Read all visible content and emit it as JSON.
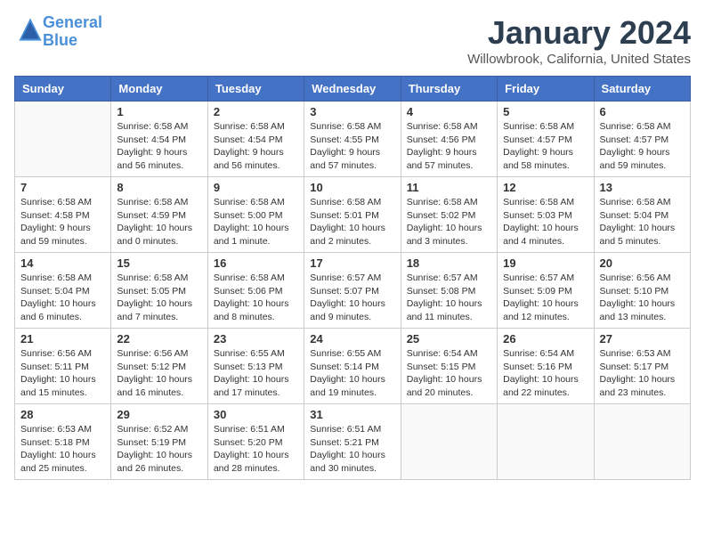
{
  "header": {
    "logo_line1": "General",
    "logo_line2": "Blue",
    "title": "January 2024",
    "location": "Willowbrook, California, United States"
  },
  "weekdays": [
    "Sunday",
    "Monday",
    "Tuesday",
    "Wednesday",
    "Thursday",
    "Friday",
    "Saturday"
  ],
  "weeks": [
    [
      {
        "day": "",
        "info": ""
      },
      {
        "day": "1",
        "info": "Sunrise: 6:58 AM\nSunset: 4:54 PM\nDaylight: 9 hours\nand 56 minutes."
      },
      {
        "day": "2",
        "info": "Sunrise: 6:58 AM\nSunset: 4:54 PM\nDaylight: 9 hours\nand 56 minutes."
      },
      {
        "day": "3",
        "info": "Sunrise: 6:58 AM\nSunset: 4:55 PM\nDaylight: 9 hours\nand 57 minutes."
      },
      {
        "day": "4",
        "info": "Sunrise: 6:58 AM\nSunset: 4:56 PM\nDaylight: 9 hours\nand 57 minutes."
      },
      {
        "day": "5",
        "info": "Sunrise: 6:58 AM\nSunset: 4:57 PM\nDaylight: 9 hours\nand 58 minutes."
      },
      {
        "day": "6",
        "info": "Sunrise: 6:58 AM\nSunset: 4:57 PM\nDaylight: 9 hours\nand 59 minutes."
      }
    ],
    [
      {
        "day": "7",
        "info": "Sunrise: 6:58 AM\nSunset: 4:58 PM\nDaylight: 9 hours\nand 59 minutes."
      },
      {
        "day": "8",
        "info": "Sunrise: 6:58 AM\nSunset: 4:59 PM\nDaylight: 10 hours\nand 0 minutes."
      },
      {
        "day": "9",
        "info": "Sunrise: 6:58 AM\nSunset: 5:00 PM\nDaylight: 10 hours\nand 1 minute."
      },
      {
        "day": "10",
        "info": "Sunrise: 6:58 AM\nSunset: 5:01 PM\nDaylight: 10 hours\nand 2 minutes."
      },
      {
        "day": "11",
        "info": "Sunrise: 6:58 AM\nSunset: 5:02 PM\nDaylight: 10 hours\nand 3 minutes."
      },
      {
        "day": "12",
        "info": "Sunrise: 6:58 AM\nSunset: 5:03 PM\nDaylight: 10 hours\nand 4 minutes."
      },
      {
        "day": "13",
        "info": "Sunrise: 6:58 AM\nSunset: 5:04 PM\nDaylight: 10 hours\nand 5 minutes."
      }
    ],
    [
      {
        "day": "14",
        "info": "Sunrise: 6:58 AM\nSunset: 5:04 PM\nDaylight: 10 hours\nand 6 minutes."
      },
      {
        "day": "15",
        "info": "Sunrise: 6:58 AM\nSunset: 5:05 PM\nDaylight: 10 hours\nand 7 minutes."
      },
      {
        "day": "16",
        "info": "Sunrise: 6:58 AM\nSunset: 5:06 PM\nDaylight: 10 hours\nand 8 minutes."
      },
      {
        "day": "17",
        "info": "Sunrise: 6:57 AM\nSunset: 5:07 PM\nDaylight: 10 hours\nand 9 minutes."
      },
      {
        "day": "18",
        "info": "Sunrise: 6:57 AM\nSunset: 5:08 PM\nDaylight: 10 hours\nand 11 minutes."
      },
      {
        "day": "19",
        "info": "Sunrise: 6:57 AM\nSunset: 5:09 PM\nDaylight: 10 hours\nand 12 minutes."
      },
      {
        "day": "20",
        "info": "Sunrise: 6:56 AM\nSunset: 5:10 PM\nDaylight: 10 hours\nand 13 minutes."
      }
    ],
    [
      {
        "day": "21",
        "info": "Sunrise: 6:56 AM\nSunset: 5:11 PM\nDaylight: 10 hours\nand 15 minutes."
      },
      {
        "day": "22",
        "info": "Sunrise: 6:56 AM\nSunset: 5:12 PM\nDaylight: 10 hours\nand 16 minutes."
      },
      {
        "day": "23",
        "info": "Sunrise: 6:55 AM\nSunset: 5:13 PM\nDaylight: 10 hours\nand 17 minutes."
      },
      {
        "day": "24",
        "info": "Sunrise: 6:55 AM\nSunset: 5:14 PM\nDaylight: 10 hours\nand 19 minutes."
      },
      {
        "day": "25",
        "info": "Sunrise: 6:54 AM\nSunset: 5:15 PM\nDaylight: 10 hours\nand 20 minutes."
      },
      {
        "day": "26",
        "info": "Sunrise: 6:54 AM\nSunset: 5:16 PM\nDaylight: 10 hours\nand 22 minutes."
      },
      {
        "day": "27",
        "info": "Sunrise: 6:53 AM\nSunset: 5:17 PM\nDaylight: 10 hours\nand 23 minutes."
      }
    ],
    [
      {
        "day": "28",
        "info": "Sunrise: 6:53 AM\nSunset: 5:18 PM\nDaylight: 10 hours\nand 25 minutes."
      },
      {
        "day": "29",
        "info": "Sunrise: 6:52 AM\nSunset: 5:19 PM\nDaylight: 10 hours\nand 26 minutes."
      },
      {
        "day": "30",
        "info": "Sunrise: 6:51 AM\nSunset: 5:20 PM\nDaylight: 10 hours\nand 28 minutes."
      },
      {
        "day": "31",
        "info": "Sunrise: 6:51 AM\nSunset: 5:21 PM\nDaylight: 10 hours\nand 30 minutes."
      },
      {
        "day": "",
        "info": ""
      },
      {
        "day": "",
        "info": ""
      },
      {
        "day": "",
        "info": ""
      }
    ]
  ]
}
